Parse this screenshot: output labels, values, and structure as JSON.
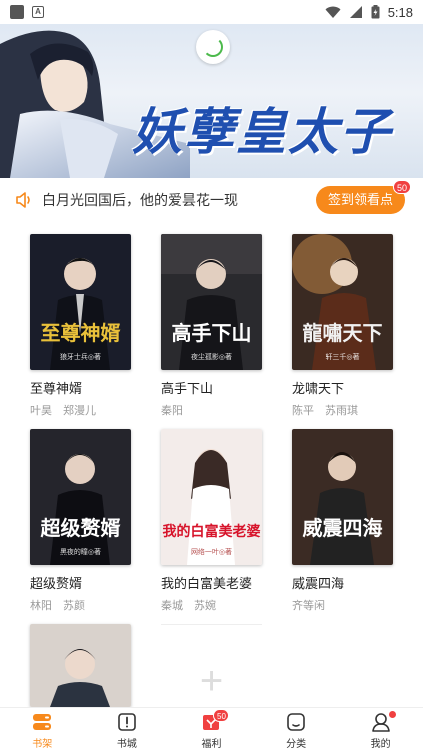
{
  "status_bar": {
    "time": "5:18"
  },
  "banner": {
    "title": "妖孽皇太子"
  },
  "notice": {
    "text": "白月光回国后，他的爱昙花一现",
    "button_label": "签到领看点",
    "button_badge": "50"
  },
  "books": [
    {
      "name": "至尊神婿",
      "sub": "叶昊　郑漫儿",
      "cover_title": "至尊神婿",
      "cover_author": "狼牙士兵◎著",
      "cover_bg": "#1a1d2a",
      "title_color": "#e9c13a"
    },
    {
      "name": "高手下山",
      "sub": "秦阳",
      "cover_title": "高手下山",
      "cover_author": "夜尘孤影◎著",
      "cover_bg": "#2a2a2e",
      "title_color": "#ffffff"
    },
    {
      "name": "龙啸天下",
      "sub": "陈平　苏雨琪",
      "cover_title": "龍嘯天下",
      "cover_author": "轩三千◎著",
      "cover_bg": "#3a2a22",
      "title_color": "#f1f1f1"
    },
    {
      "name": "超级赘婿",
      "sub": "林阳　苏颜",
      "cover_title": "超级赘婿",
      "cover_author": "黑夜的瞳◎著",
      "cover_bg": "#25252c",
      "title_color": "#ffffff"
    },
    {
      "name": "我的白富美老婆",
      "sub": "秦城　苏婉",
      "cover_title": "我的白富美老婆",
      "cover_author": "网络一叶◎著",
      "cover_bg": "#f3ecea",
      "title_color": "#d7142b"
    },
    {
      "name": "威震四海",
      "sub": "齐等闲",
      "cover_title": "威震四海",
      "cover_author": "",
      "cover_bg": "#3b2b24",
      "title_color": "#ffffff"
    },
    {
      "name": "",
      "sub": "",
      "cover_title": "",
      "cover_author": "",
      "cover_bg": "#d9d2cc",
      "title_color": "#ffffff"
    }
  ],
  "nav": [
    {
      "label": "书架",
      "icon": "bookshelf-icon",
      "active": true
    },
    {
      "label": "书城",
      "icon": "bookstore-icon"
    },
    {
      "label": "福利",
      "icon": "gift-icon",
      "badge": "50"
    },
    {
      "label": "分类",
      "icon": "category-icon"
    },
    {
      "label": "我的",
      "icon": "profile-icon",
      "dot": true
    }
  ],
  "colors": {
    "accent": "#f7891b",
    "badge": "#f04040"
  }
}
